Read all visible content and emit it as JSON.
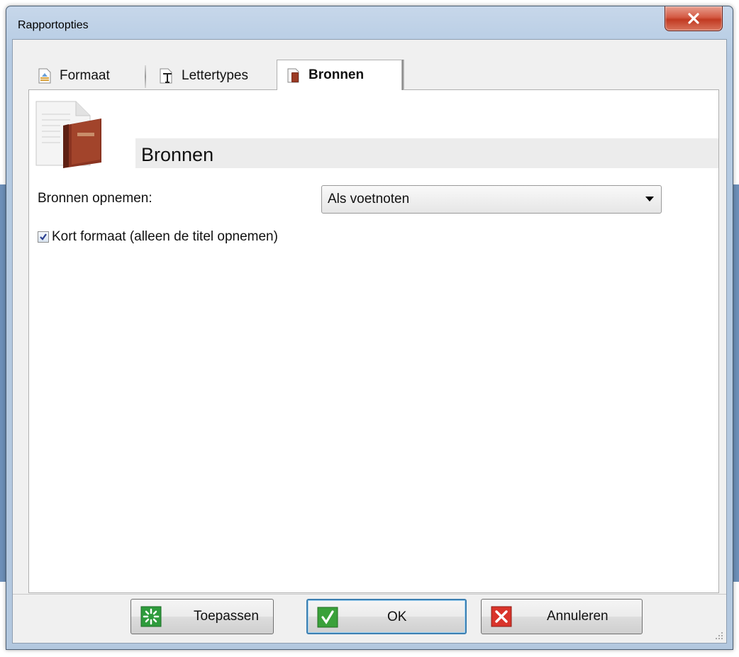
{
  "window": {
    "title": "Rapportopties"
  },
  "tabs": [
    {
      "label": "Formaat",
      "icon": "format-icon",
      "active": false
    },
    {
      "label": "Lettertypes",
      "icon": "font-icon",
      "active": false
    },
    {
      "label": "Bronnen",
      "icon": "sources-icon",
      "active": true
    }
  ],
  "panel": {
    "title": "Bronnen",
    "sources_label": "Bronnen opnemen:",
    "sources_select": {
      "value": "Als voetnoten"
    },
    "short_format": {
      "label": "Kort formaat (alleen de titel opnemen)",
      "checked": true
    }
  },
  "buttons": {
    "apply": {
      "label": "Toepassen",
      "icon": "apply-icon"
    },
    "ok": {
      "label": "OK",
      "icon": "check-icon"
    },
    "cancel": {
      "label": "Annuleren",
      "icon": "cancel-x-icon"
    }
  },
  "colors": {
    "accent": "#3c7fb1",
    "close": "#c13a22",
    "apply": "#2e9b3c",
    "ok": "#3aa13a",
    "cancel": "#d9342b"
  }
}
